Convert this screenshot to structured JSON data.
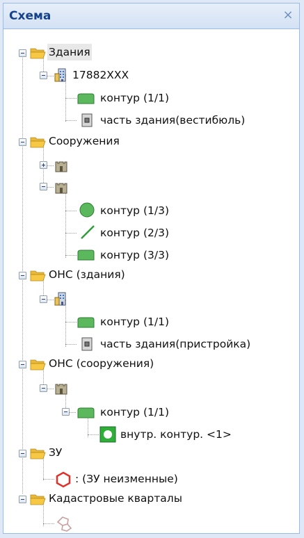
{
  "panel": {
    "title": "Схема",
    "close_symbol": "×"
  },
  "tree": {
    "nodes": {
      "buildings": "Здания",
      "building_1": "17882XXX",
      "building_1_contour": "контур (1/1)",
      "building_1_part": "часть здания(вестибюль)",
      "structures": "Сооружения",
      "structure_2_contour_1": "контур (1/3)",
      "structure_2_contour_2": "контур (2/3)",
      "structure_2_contour_3": "контур (3/3)",
      "ons_buildings": "ОНС (здания)",
      "ons_building_contour": "контур (1/1)",
      "ons_building_part": "часть здания(пристройка)",
      "ons_structures": "ОНС (сооружения)",
      "ons_structure_contour": "контур (1/1)",
      "ons_structure_inner": "внутр. контур. <1>",
      "land": "ЗУ",
      "land_unchanged": ": (ЗУ неизменные)",
      "cadastral": "Кадастровые кварталы"
    },
    "icons": {
      "folder": "folder-open-icon",
      "building": "building-icon",
      "structure": "tower-icon",
      "contour": "green-contour-icon",
      "part": "building-part-icon",
      "circle": "green-circle-icon",
      "line": "green-line-icon",
      "inner": "inner-contour-icon",
      "hexagon": "red-hexagon-icon",
      "quarter": "cadastral-quarter-icon"
    },
    "colors": {
      "header_text": "#15428b",
      "folder": "#f6c843",
      "contour_green": "#4caf50",
      "hexagon_red": "#e0322b"
    }
  }
}
